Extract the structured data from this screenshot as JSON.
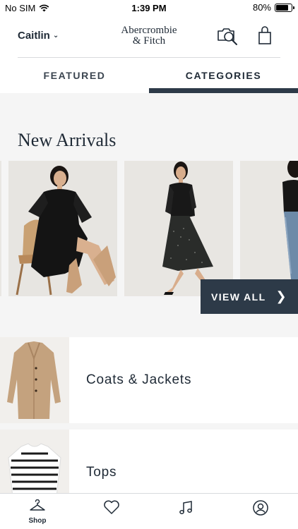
{
  "status_bar": {
    "carrier": "No SIM",
    "time": "1:39 PM",
    "battery": "80%"
  },
  "header": {
    "user": "Caitlin",
    "brand_line1": "Abercrombie",
    "brand_line2": "& Fitch"
  },
  "tabs": [
    {
      "label": "FEATURED",
      "active": false
    },
    {
      "label": "CATEGORIES",
      "active": true
    }
  ],
  "new_arrivals": {
    "title": "New Arrivals",
    "view_all_label": "VIEW ALL"
  },
  "categories": [
    {
      "label": "Coats & Jackets"
    },
    {
      "label": "Tops"
    }
  ],
  "bottom_nav": [
    {
      "icon": "hanger-icon",
      "label": "Shop",
      "active": true
    },
    {
      "icon": "heart-icon",
      "label": ""
    },
    {
      "icon": "music-note-icon",
      "label": ""
    },
    {
      "icon": "account-icon",
      "label": ""
    }
  ],
  "colors": {
    "navy": "#2d3a48",
    "text": "#1f2a36",
    "background": "#f5f5f5"
  }
}
